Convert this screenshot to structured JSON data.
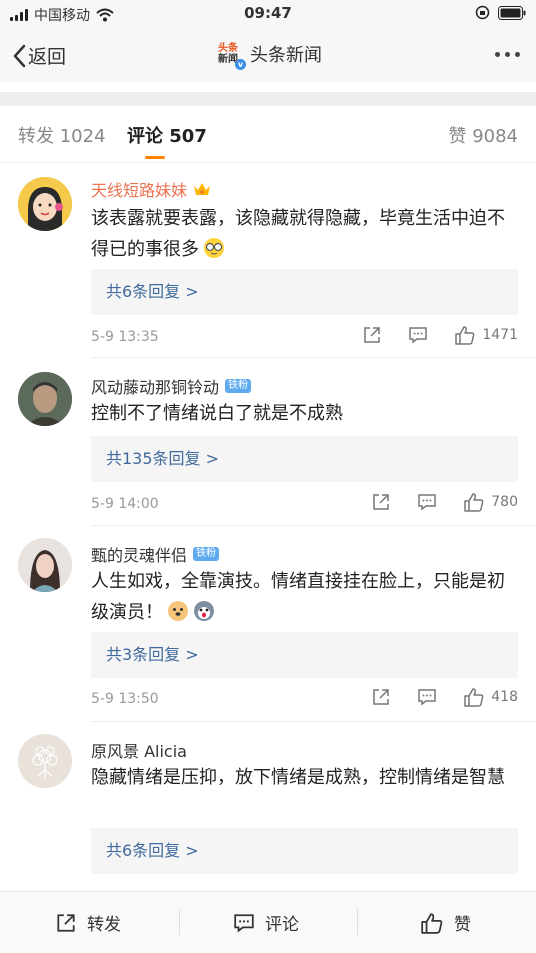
{
  "status_bar": {
    "carrier": "中国移动",
    "time": "09:47"
  },
  "nav": {
    "back_label": "返回",
    "logo_top": "头条",
    "logo_bottom": "新闻",
    "title": "头条新闻"
  },
  "tabs": [
    {
      "label": "转发 1024"
    },
    {
      "label": "评论 507"
    },
    {
      "label": "赞 9084"
    }
  ],
  "comments": [
    {
      "name": "天线短路妹妹",
      "name_color": "#eb7350",
      "badge": "",
      "text": "该表露就要表露，该隐藏就得隐藏，毕竟生活中迫不得已的事很多",
      "replies": "共6条回复 >",
      "time": "5-9 13:35",
      "likes": "1471",
      "avatar_icon": "cartoon-girl-avatar"
    },
    {
      "name": "风动藤动那铜铃动",
      "name_color": "#333333",
      "badge": "铁粉",
      "text": "控制不了情绪说白了就是不成熟",
      "replies": "共135条回复 >",
      "time": "5-9 14:00",
      "likes": "780",
      "avatar_icon": "man-photo-avatar"
    },
    {
      "name": "甄的灵魂伴侣",
      "name_color": "#333333",
      "badge": "铁粉",
      "text": "人生如戏，全靠演技。情绪直接挂在脸上，只能是初级演员！",
      "replies": "共3条回复 >",
      "time": "5-9 13:50",
      "likes": "418",
      "avatar_icon": "woman-photo-avatar"
    },
    {
      "name": "原风景 Alicia",
      "name_color": "#333333",
      "badge": "",
      "text": "隐藏情绪是压抑，放下情绪是成熟，控制情绪是智慧",
      "replies": "共6条回复 >",
      "time": "",
      "likes": "",
      "avatar_icon": "flower-avatar"
    }
  ],
  "bottom_bar": {
    "repost_label": "转发",
    "comment_label": "评论",
    "like_label": "赞"
  },
  "colors": {
    "accent": "#ff8200",
    "link": "#3f6a9b",
    "vip_name": "#eb7350"
  }
}
